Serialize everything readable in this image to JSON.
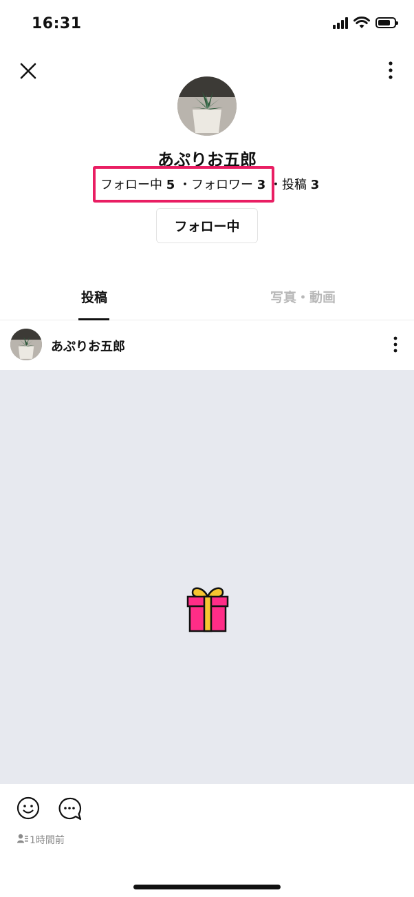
{
  "status_bar": {
    "time": "16:31",
    "battery_level": 0.75
  },
  "profile": {
    "name": "あぷりお五郎",
    "following_label": "フォロー中",
    "following_count": "5",
    "followers_label": "・フォロワー",
    "followers_count": "3",
    "posts_label": "・投稿",
    "posts_count": "3",
    "follow_button_label": "フォロー中"
  },
  "tabs": [
    {
      "label": "投稿",
      "active": true
    },
    {
      "label": "写真・動画",
      "active": false
    }
  ],
  "post": {
    "author": "あぷりお五郎",
    "time": "1時間前"
  },
  "colors": {
    "highlight": "#e91e63",
    "media_background": "#e7e9ef",
    "gift_box": "#ff2d87",
    "gift_ribbon": "#f7c531"
  },
  "icons": {
    "close": "close-icon",
    "more": "more-vertical-icon",
    "reaction": "smiley-icon",
    "comment": "comment-bubble-icon",
    "gift": "gift-icon",
    "visibility": "friends-visibility-icon"
  }
}
